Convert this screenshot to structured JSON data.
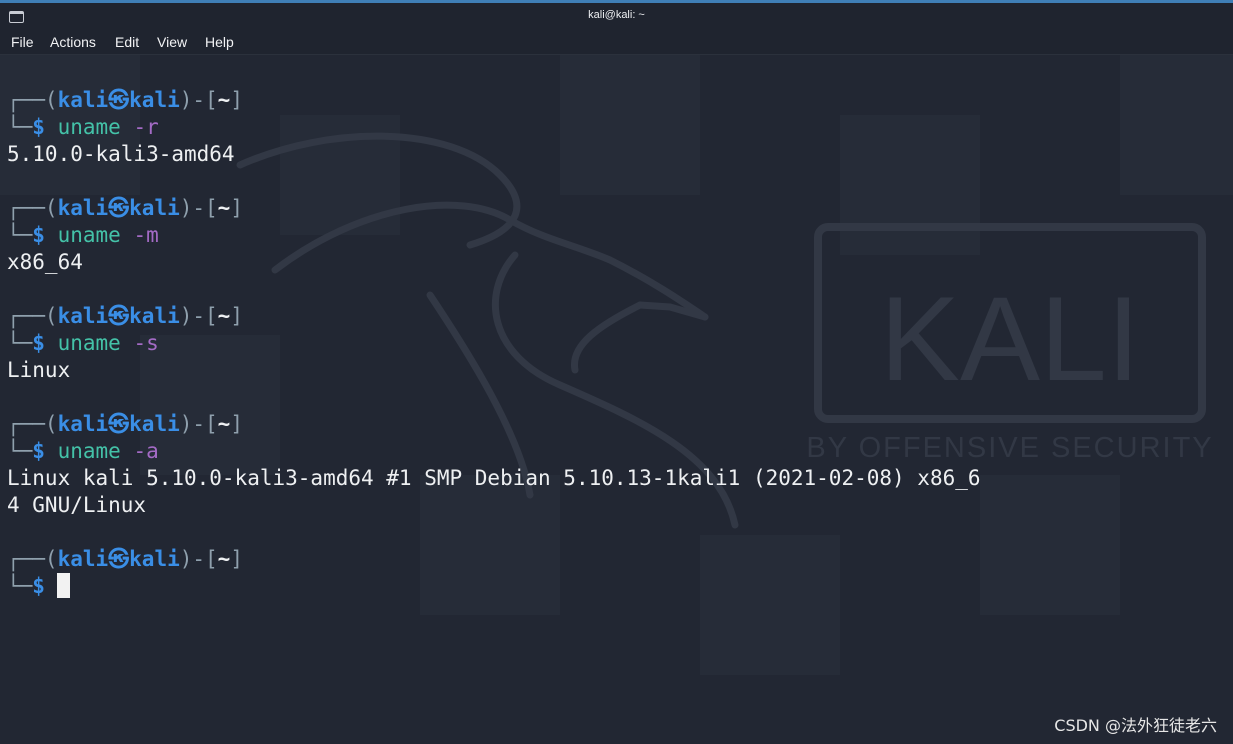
{
  "window": {
    "title": "kali@kali: ~"
  },
  "menu": [
    "File",
    "Actions",
    "Edit",
    "View",
    "Help"
  ],
  "prompt": {
    "open": "┌──(",
    "user": "kali",
    "symbol": "㉿",
    "host": "kali",
    "close": ")-[",
    "dir": "~",
    "end": "]",
    "corner": "└─",
    "dollar": "$"
  },
  "blocks": [
    {
      "cmd": "uname",
      "arg": "-r",
      "output": [
        "5.10.0-kali3-amd64"
      ]
    },
    {
      "cmd": "uname",
      "arg": "-m",
      "output": [
        "x86_64"
      ]
    },
    {
      "cmd": "uname",
      "arg": "-s",
      "output": [
        "Linux"
      ]
    },
    {
      "cmd": "uname",
      "arg": "-a",
      "output": [
        "Linux kali 5.10.0-kali3-amd64 #1 SMP Debian 5.10.13-1kali1 (2021-02-08) x86_6",
        "4 GNU/Linux"
      ]
    }
  ],
  "background": {
    "logo": "KALI",
    "tagline": "BY OFFENSIVE SECURITY"
  },
  "watermark": "CSDN @法外狂徒老六",
  "colors": {
    "user": "#3a8ee6",
    "command": "#44c2a8",
    "argument": "#a46bc6",
    "background": "#222733"
  }
}
